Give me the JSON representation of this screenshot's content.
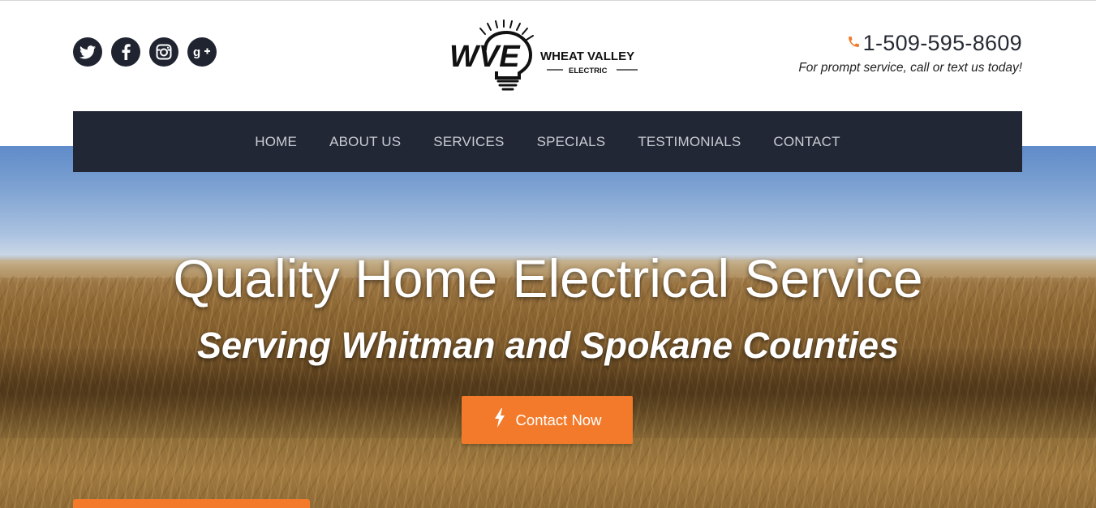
{
  "header": {
    "social": [
      {
        "name": "twitter-icon"
      },
      {
        "name": "facebook-icon"
      },
      {
        "name": "instagram-icon"
      },
      {
        "name": "google-plus-icon"
      }
    ],
    "logo": {
      "monogram": "WVE",
      "name_line1": "WHEAT VALLEY",
      "name_line2": "ELECTRIC"
    },
    "phone": {
      "number": "1-509-595-8609",
      "tagline": "For prompt service, call or text us today!",
      "icon": "phone-icon"
    }
  },
  "nav": {
    "items": [
      "HOME",
      "ABOUT US",
      "SERVICES",
      "SPECIALS",
      "TESTIMONIALS",
      "CONTACT"
    ]
  },
  "hero": {
    "title": "Quality Home Electrical Service",
    "subtitle": "Serving Whitman and Spokane Counties",
    "cta_label": "Contact Now",
    "cta_icon": "lightning-icon"
  },
  "colors": {
    "accent": "#f37a2a",
    "nav_bg": "#222736",
    "social_bg": "#1f2430"
  }
}
